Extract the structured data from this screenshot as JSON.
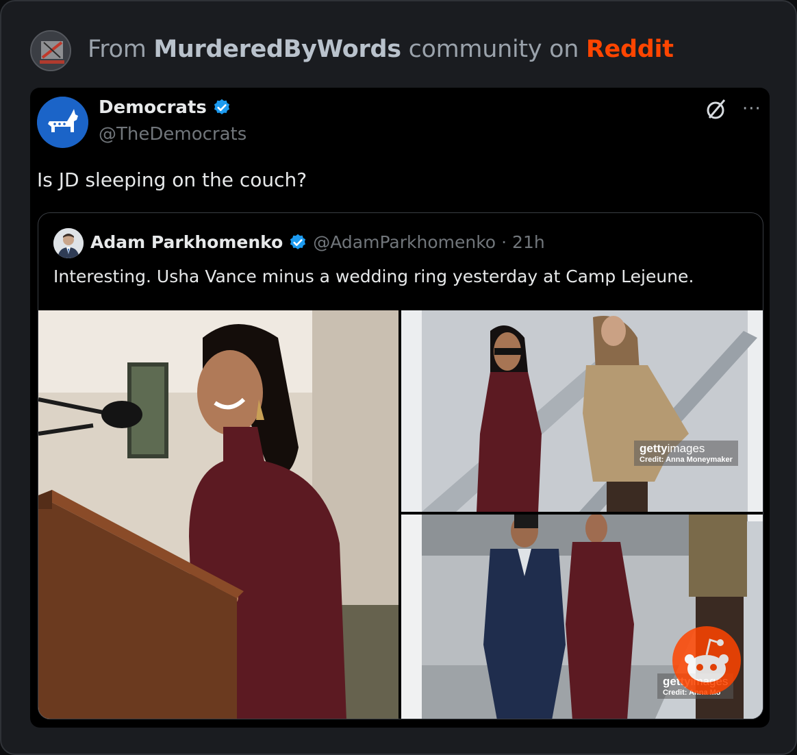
{
  "header": {
    "prefix": "From",
    "community": "MurderedByWords",
    "middle": "community on",
    "platform": "Reddit",
    "community_avatar_icon": "murderedbywords-avatar-icon",
    "accent_color": "#ff4500"
  },
  "tweet": {
    "author_name": "Democrats",
    "author_handle": "@TheDemocrats",
    "verified": true,
    "text": "Is JD sleeping on the couch?",
    "icons": [
      "grok-icon",
      "more-icon"
    ],
    "more_label": "···"
  },
  "quoted": {
    "author_name": "Adam Parkhomenko",
    "author_handle": "@AdamParkhomenko",
    "separator": "·",
    "time": "21h",
    "text": "Interesting. Usha Vance minus a wedding ring yesterday at Camp Lejeune.",
    "photos": [
      {
        "alt": "woman at podium speaking"
      },
      {
        "alt": "two women descending airplane stairs",
        "watermark_brand": "getty",
        "watermark_brand_thin": "images",
        "watermark_credit": "Credit: Anna Moneymaker"
      },
      {
        "alt": "woman descending airplane stairs next to service member",
        "watermark_brand": "getty",
        "watermark_brand_thin": "images",
        "watermark_credit": "Credit: Anna Mo"
      }
    ]
  },
  "colors": {
    "verified_blue": "#1d9bf0",
    "background": "#000000",
    "secondary_text": "#71767b"
  }
}
